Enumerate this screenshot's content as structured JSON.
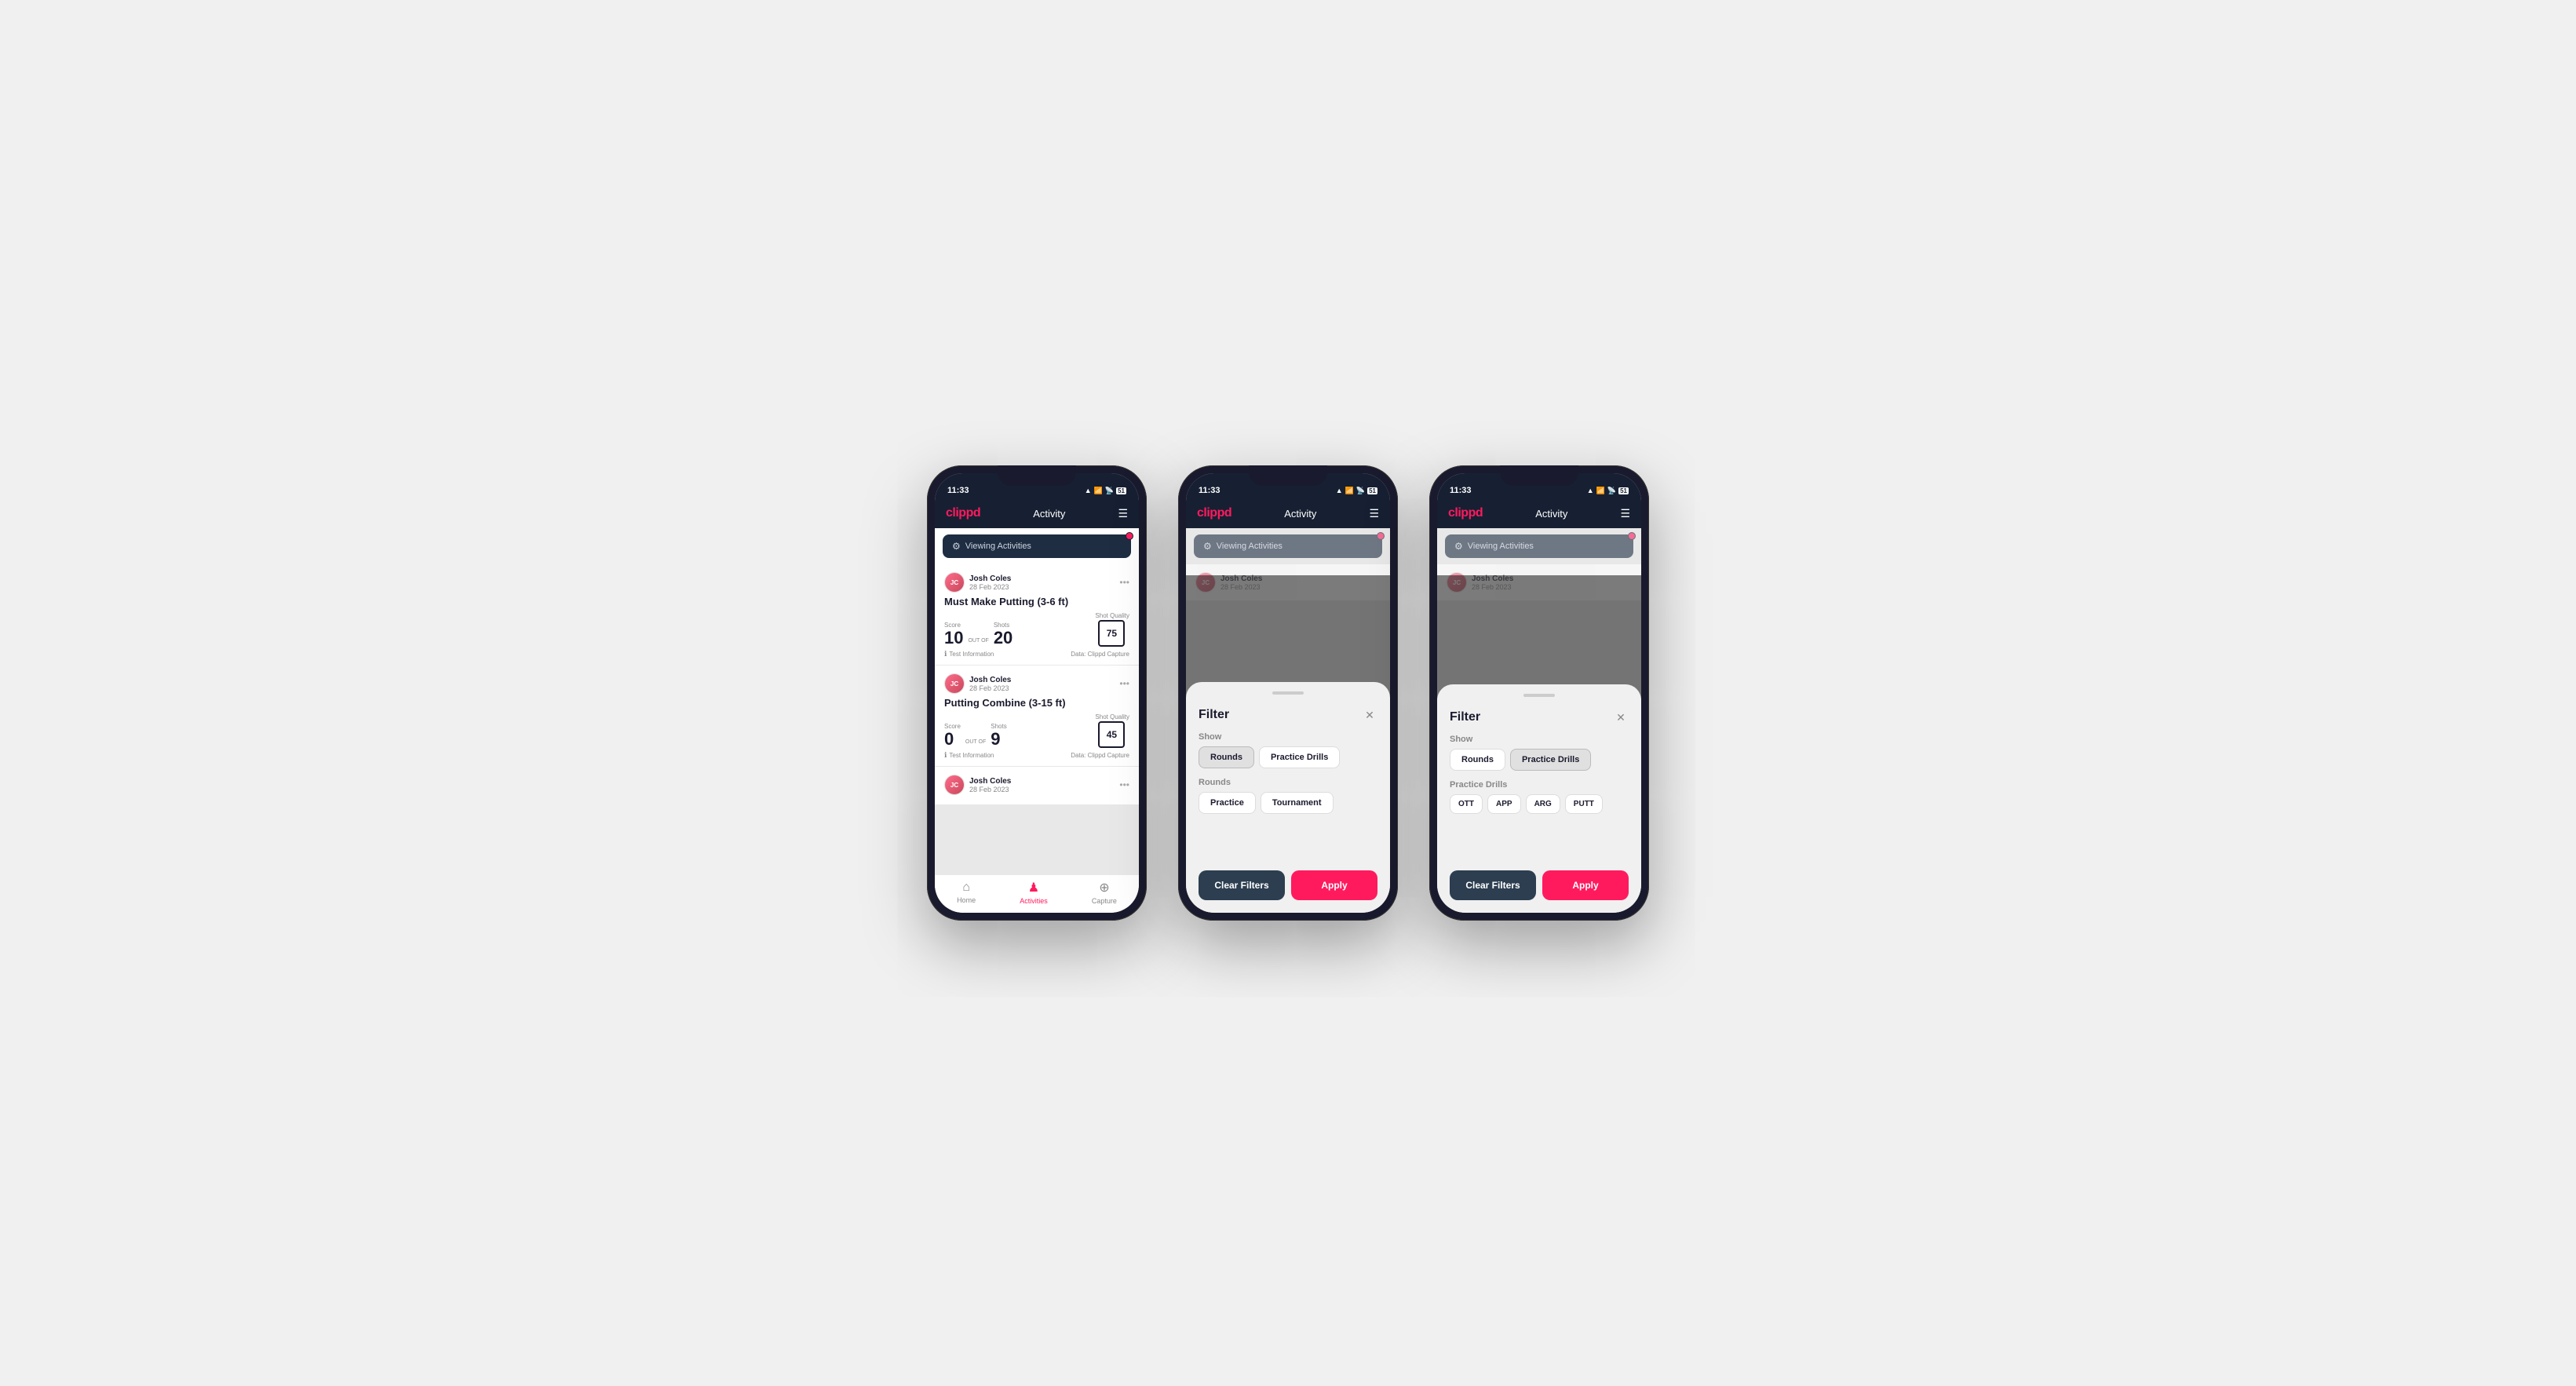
{
  "phones": [
    {
      "id": "phone1",
      "statusBar": {
        "time": "11:33",
        "icons": "▲ ▼ ☁"
      },
      "header": {
        "logo": "clippd",
        "title": "Activity",
        "menuIcon": "☰"
      },
      "viewingBanner": {
        "icon": "⚙",
        "text": "Viewing Activities"
      },
      "activities": [
        {
          "user": "Josh Coles",
          "date": "28 Feb 2023",
          "title": "Must Make Putting (3-6 ft)",
          "scoreLine": {
            "scoreLabel": "Score",
            "scoreValue": "10",
            "outOfLabel": "OUT OF",
            "shotsLabel": "Shots",
            "shotsValue": "20",
            "sqLabel": "Shot Quality",
            "sqValue": "75"
          },
          "testInfo": "Test Information",
          "dataSource": "Data: Clippd Capture"
        },
        {
          "user": "Josh Coles",
          "date": "28 Feb 2023",
          "title": "Putting Combine (3-15 ft)",
          "scoreLine": {
            "scoreLabel": "Score",
            "scoreValue": "0",
            "outOfLabel": "OUT OF",
            "shotsLabel": "Shots",
            "shotsValue": "9",
            "sqLabel": "Shot Quality",
            "sqValue": "45"
          },
          "testInfo": "Test Information",
          "dataSource": "Data: Clippd Capture"
        },
        {
          "user": "Josh Coles",
          "date": "28 Feb 2023",
          "title": "",
          "scoreLine": null
        }
      ],
      "bottomNav": [
        {
          "icon": "⌂",
          "label": "Home",
          "active": false
        },
        {
          "icon": "♟",
          "label": "Activities",
          "active": true
        },
        {
          "icon": "+",
          "label": "Capture",
          "active": false
        }
      ]
    },
    {
      "id": "phone2",
      "showModal": true,
      "modalType": "rounds",
      "statusBar": {
        "time": "11:33"
      },
      "header": {
        "logo": "clippd",
        "title": "Activity",
        "menuIcon": "☰"
      },
      "viewingBanner": {
        "icon": "⚙",
        "text": "Viewing Activities"
      },
      "filter": {
        "title": "Filter",
        "showLabel": "Show",
        "showButtons": [
          {
            "label": "Rounds",
            "selected": true
          },
          {
            "label": "Practice Drills",
            "selected": false
          }
        ],
        "roundsLabel": "Rounds",
        "roundsButtons": [
          {
            "label": "Practice",
            "selected": false
          },
          {
            "label": "Tournament",
            "selected": false
          }
        ],
        "clearLabel": "Clear Filters",
        "applyLabel": "Apply"
      }
    },
    {
      "id": "phone3",
      "showModal": true,
      "modalType": "practice",
      "statusBar": {
        "time": "11:33"
      },
      "header": {
        "logo": "clippd",
        "title": "Activity",
        "menuIcon": "☰"
      },
      "viewingBanner": {
        "icon": "⚙",
        "text": "Viewing Activities"
      },
      "filter": {
        "title": "Filter",
        "showLabel": "Show",
        "showButtons": [
          {
            "label": "Rounds",
            "selected": false
          },
          {
            "label": "Practice Drills",
            "selected": true
          }
        ],
        "practiceLabel": "Practice Drills",
        "practiceButtons": [
          {
            "label": "OTT",
            "selected": false
          },
          {
            "label": "APP",
            "selected": false
          },
          {
            "label": "ARG",
            "selected": false
          },
          {
            "label": "PUTT",
            "selected": false
          }
        ],
        "clearLabel": "Clear Filters",
        "applyLabel": "Apply"
      }
    }
  ]
}
